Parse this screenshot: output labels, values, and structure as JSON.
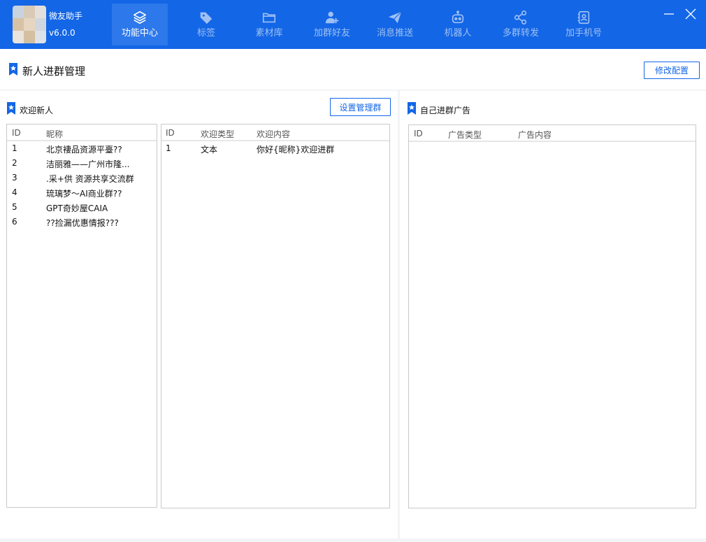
{
  "app": {
    "name": "微友助手",
    "version": "v6.0.0"
  },
  "nav": {
    "items": [
      {
        "label": "功能中心",
        "icon": "layers-icon"
      },
      {
        "label": "标签",
        "icon": "tag-icon"
      },
      {
        "label": "素材库",
        "icon": "folder-icon"
      },
      {
        "label": "加群好友",
        "icon": "add-user-icon"
      },
      {
        "label": "消息推送",
        "icon": "paper-plane-icon"
      },
      {
        "label": "机器人",
        "icon": "robot-icon"
      },
      {
        "label": "多群转发",
        "icon": "share-icon"
      },
      {
        "label": "加手机号",
        "icon": "contact-card-icon"
      }
    ]
  },
  "page": {
    "title": "新人进群管理",
    "edit_config_label": "修改配置"
  },
  "welcome": {
    "title": "欢迎新人",
    "set_admin_group_label": "设置管理群",
    "groups_table": {
      "columns": [
        "ID",
        "昵称"
      ],
      "rows": [
        [
          "1",
          "北京褄品资源平臺??"
        ],
        [
          "2",
          "洁丽雅——广州市隆..."
        ],
        [
          "3",
          ".采+供 资源共享交流群"
        ],
        [
          "4",
          "琉璃梦～AI商业群??"
        ],
        [
          "5",
          "GPT奇妙屋CAIA"
        ],
        [
          "6",
          "??捡漏优惠情报???"
        ]
      ]
    },
    "messages_table": {
      "columns": [
        "ID",
        "欢迎类型",
        "欢迎内容"
      ],
      "rows": [
        [
          "1",
          "文本",
          "你好{昵称}欢迎进群"
        ]
      ]
    }
  },
  "ads": {
    "title": "自己进群广告",
    "table": {
      "columns": [
        "ID",
        "广告类型",
        "广告内容"
      ],
      "rows": []
    }
  },
  "colors": {
    "primary": "#1366e6",
    "active_tab": "#2d78ea",
    "inactive_nav_text": "#9fc0f4"
  }
}
